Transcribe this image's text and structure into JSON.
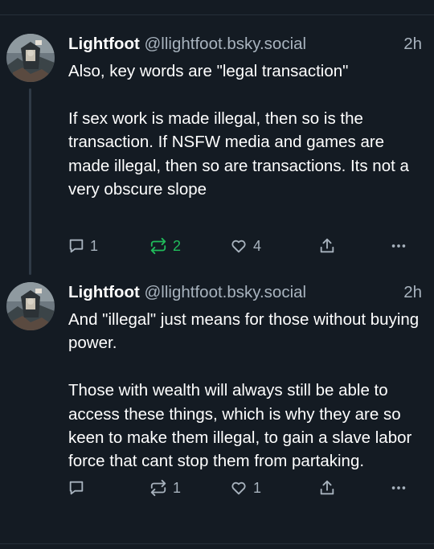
{
  "posts": [
    {
      "author": "Lightfoot",
      "handle": "@llightfoot.bsky.social",
      "time": "2h",
      "paragraphs": [
        "Also, key words are \"legal transaction\"",
        "If sex work is made illegal, then so is the transaction. If NSFW media and games are made illegal, then so are transactions. Its not a very obscure slope"
      ],
      "replies": "1",
      "reposts": "2",
      "likes": "4",
      "reposted": true
    },
    {
      "author": "Lightfoot",
      "handle": "@llightfoot.bsky.social",
      "time": "2h",
      "paragraphs": [
        "And \"illegal\" just means for those without buying power.",
        "Those with wealth will always still be able to access these things, which is why they are so keen to make them illegal, to gain a slave labor force that cant stop them from partaking."
      ],
      "replies": "",
      "reposts": "1",
      "likes": "1",
      "reposted": false
    }
  ],
  "icons": {
    "reply": "reply-icon",
    "repost": "repost-icon",
    "like": "heart-icon",
    "share": "share-icon",
    "more": "more-icon"
  },
  "colors": {
    "background": "#141b23",
    "muted": "#a8b3be",
    "repost_active": "#20bc5b"
  }
}
